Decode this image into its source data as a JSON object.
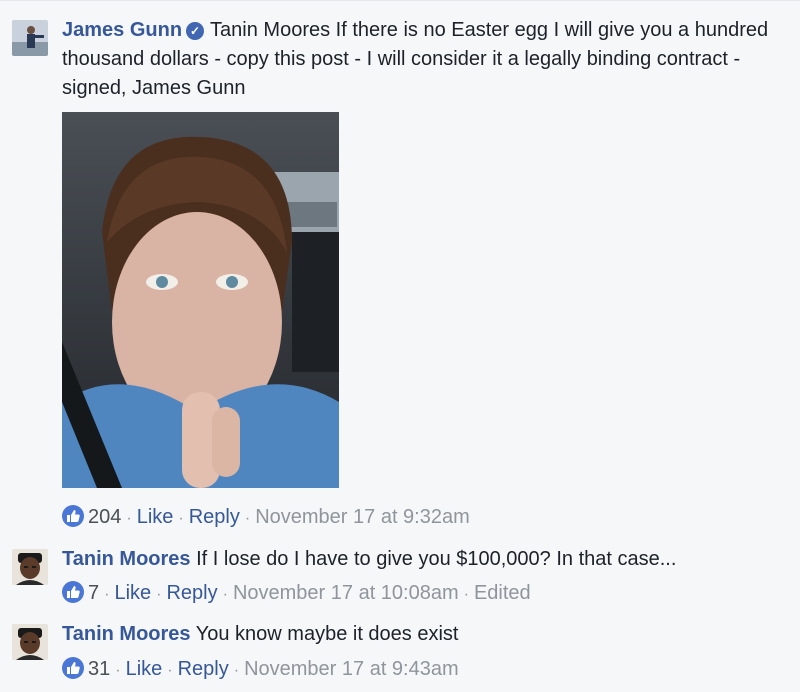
{
  "comments": [
    {
      "author": "James Gunn",
      "text": "Tanin Moores If there is no Easter egg I will give you a hundred thousand dollars - copy this post - I will consider it a legally binding contract - signed, James Gunn",
      "likes": "204",
      "like_label": "Like",
      "reply_label": "Reply",
      "time": "November 17 at 9:32am"
    },
    {
      "author": "Tanin Moores",
      "text": "If I lose do I have to give you $100,000? In that case...",
      "likes": "7",
      "like_label": "Like",
      "reply_label": "Reply",
      "time": "November 17 at 10:08am",
      "edited": "Edited"
    },
    {
      "author": "Tanin Moores",
      "text": "You know maybe it does exist",
      "likes": "31",
      "like_label": "Like",
      "reply_label": "Reply",
      "time": "November 17 at 9:43am"
    }
  ],
  "colors": {
    "link": "#365899",
    "meta": "#90949c",
    "like_badge": "#4a76d5",
    "background": "#f6f7f9"
  },
  "icons": [
    "verified-badge-icon",
    "thumbs-up-icon"
  ]
}
